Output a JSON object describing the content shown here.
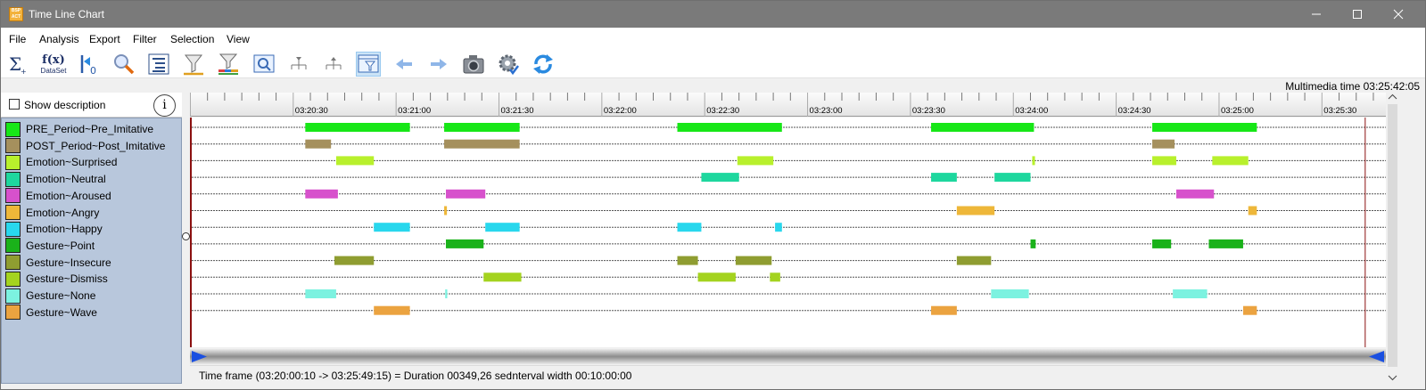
{
  "window": {
    "title": "Time Line Chart",
    "app_icon": "app-logo-icon",
    "controls": [
      "minimize-icon",
      "maximize-icon",
      "close-icon"
    ]
  },
  "menu": [
    "File",
    "Analysis",
    "Export",
    "Filter",
    "Selection",
    "View"
  ],
  "toolbar": {
    "buttons": [
      {
        "name": "statistics-icon",
        "label": ""
      },
      {
        "name": "dataset-function-icon",
        "label": "DataSet"
      },
      {
        "name": "go-to-start-icon",
        "label": ""
      },
      {
        "name": "zoom-icon",
        "label": ""
      },
      {
        "name": "tree-list-icon",
        "label": ""
      },
      {
        "name": "filter-icon",
        "label": ""
      },
      {
        "name": "filter-colors-icon",
        "label": ""
      },
      {
        "name": "search-window-icon",
        "label": ""
      },
      {
        "name": "tree-collapse-icon",
        "label": ""
      },
      {
        "name": "tree-expand-icon",
        "label": ""
      },
      {
        "name": "filter-view-icon",
        "label": "",
        "active": true
      },
      {
        "name": "arrow-left-icon",
        "label": ""
      },
      {
        "name": "arrow-right-icon",
        "label": ""
      },
      {
        "name": "camera-icon",
        "label": ""
      },
      {
        "name": "settings-icon",
        "label": ""
      },
      {
        "name": "refresh-icon",
        "label": ""
      }
    ],
    "dataset_label": "DataSet",
    "fx_label": "f(x)"
  },
  "multimedia_time": "Multimedia time 03:25:42:05",
  "show_description": {
    "label": "Show description",
    "checked": false
  },
  "info_symbol": "i",
  "ruler": {
    "tick_labels": [
      "03:20:30",
      "03:21:00",
      "03:21:30",
      "03:22:00",
      "03:22:30",
      "03:23:00",
      "03:23:30",
      "03:24:00",
      "03:24:30",
      "03:25:00",
      "03:25:30"
    ]
  },
  "chart_data": {
    "type": "timeline",
    "time_unit": "seconds since 03:20:00",
    "x_axis_ticks": [
      "03:20:30",
      "03:21:00",
      "03:21:30",
      "03:22:00",
      "03:22:30",
      "03:23:00",
      "03:23:30",
      "03:24:00",
      "03:24:30",
      "03:25:00",
      "03:25:30"
    ],
    "xlim": [
      0.17,
      349.25
    ],
    "cursor_time": "03:25:42:05",
    "series": [
      {
        "name": "PRE_Period~Pre_Imitative",
        "color": "#17e717",
        "intervals": [
          [
            33,
            63.5
          ],
          [
            73.5,
            95.5
          ],
          [
            141.5,
            172
          ],
          [
            215.5,
            245.5
          ],
          [
            280,
            310.5
          ]
        ]
      },
      {
        "name": "POST_Period~Post_Imitative",
        "color": "#a5905d",
        "intervals": [
          [
            33,
            40.5
          ],
          [
            73.5,
            95.5
          ],
          [
            280,
            286.5
          ]
        ]
      },
      {
        "name": "Emotion~Surprised",
        "color": "#b8f02c",
        "intervals": [
          [
            42,
            53
          ],
          [
            159,
            169.5
          ],
          [
            245,
            245.8
          ],
          [
            280,
            287
          ],
          [
            297.5,
            308
          ]
        ]
      },
      {
        "name": "Emotion~Neutral",
        "color": "#1ed79e",
        "intervals": [
          [
            148.5,
            159.5
          ],
          [
            215.5,
            223
          ],
          [
            234,
            244.5
          ]
        ]
      },
      {
        "name": "Emotion~Aroused",
        "color": "#d751cc",
        "intervals": [
          [
            33,
            42.5
          ],
          [
            74,
            85.5
          ],
          [
            287,
            298
          ]
        ]
      },
      {
        "name": "Emotion~Angry",
        "color": "#eeb739",
        "intervals": [
          [
            73.5,
            74.3
          ],
          [
            223,
            234
          ],
          [
            308,
            310.5
          ]
        ]
      },
      {
        "name": "Emotion~Happy",
        "color": "#28d7ed",
        "intervals": [
          [
            53,
            63.5
          ],
          [
            85.5,
            95.5
          ],
          [
            141.5,
            148.5
          ],
          [
            170,
            172
          ]
        ]
      },
      {
        "name": "Gesture~Point",
        "color": "#1ab21a",
        "intervals": [
          [
            74,
            85
          ],
          [
            244.5,
            246
          ],
          [
            280,
            285.5
          ],
          [
            296.5,
            306.5
          ]
        ]
      },
      {
        "name": "Gesture~Insecure",
        "color": "#8f9d31",
        "intervals": [
          [
            41.5,
            53
          ],
          [
            141.5,
            147.5
          ],
          [
            158.5,
            169
          ],
          [
            223,
            233
          ]
        ]
      },
      {
        "name": "Gesture~Dismiss",
        "color": "#a4d31f",
        "intervals": [
          [
            85,
            96
          ],
          [
            147.5,
            158.5
          ],
          [
            168.5,
            171.5
          ]
        ]
      },
      {
        "name": "Gesture~None",
        "color": "#7cf2e0",
        "intervals": [
          [
            33,
            42
          ],
          [
            73.8,
            74.4
          ],
          [
            233,
            244
          ],
          [
            286,
            296
          ]
        ]
      },
      {
        "name": "Gesture~Wave",
        "color": "#eba340",
        "intervals": [
          [
            53,
            63.5
          ],
          [
            215.5,
            223
          ],
          [
            306.5,
            310.5
          ]
        ]
      }
    ]
  },
  "status": {
    "time_frame": "Time frame  (03:20:00:10 -> 03:25:49:15) = Duration 00349,26 sec",
    "interval_width": "Interval width 00:10:00:00"
  }
}
